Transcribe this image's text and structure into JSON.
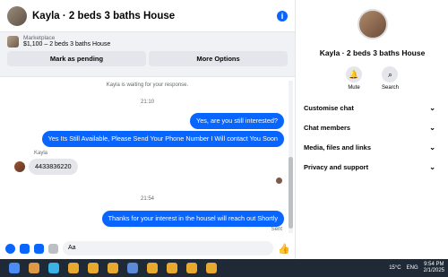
{
  "header": {
    "title": "Kayla · 2 beds 3 baths House",
    "info_icon": "i"
  },
  "marketplace": {
    "label": "Marketplace",
    "listing": "$1,100 – 2 beds 3 baths House",
    "pending_btn": "Mark as pending",
    "more_btn": "More Options"
  },
  "messages": {
    "waiting": "Kayla is waiting for your response.",
    "time1": "21:10",
    "out1": "Yes, are you still interested?",
    "out2": "Yes Its Still Available, Please Send Your Phone Number I Will contact You Soon",
    "sender": "Kayla",
    "in1": "4433836220",
    "time2": "21:54",
    "out3": "Thanks for your interest in the housel will reach out Shortly",
    "status": "Sent"
  },
  "composer": {
    "placeholder": "Aa",
    "like": "👍"
  },
  "side": {
    "name": "Kayla · 2 beds 3 baths House",
    "mute": "Mute",
    "search": "Search",
    "rows": [
      "Customise chat",
      "Chat members",
      "Media, files and links",
      "Privacy and support"
    ],
    "chevron": "⌄"
  },
  "taskbar": {
    "temp": "15°C",
    "lang": "ENG",
    "time": "9:54 PM",
    "date": "2/1/2025"
  }
}
